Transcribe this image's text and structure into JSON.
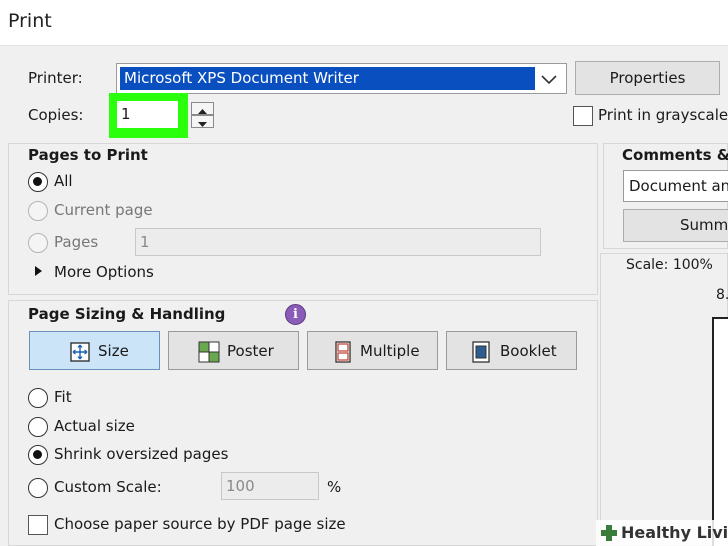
{
  "window": {
    "title": "Print"
  },
  "printer": {
    "label": "Printer:",
    "selected": "Microsoft XPS Document Writer",
    "properties_label": "Properties"
  },
  "copies": {
    "label": "Copies:",
    "value": "1"
  },
  "grayscale": {
    "label": "Print in grayscale (",
    "checked": false
  },
  "pages_to_print": {
    "heading": "Pages to Print",
    "all_label": "All",
    "current_page_label": "Current page",
    "pages_label": "Pages",
    "pages_value": "1",
    "more_options_label": "More Options",
    "selected": "All"
  },
  "page_sizing": {
    "heading": "Page Sizing & Handling",
    "info_icon_glyph": "i",
    "modes": [
      {
        "label": "Size",
        "icon": "size-icon",
        "active": true
      },
      {
        "label": "Poster",
        "icon": "poster-icon",
        "active": false
      },
      {
        "label": "Multiple",
        "icon": "multiple-icon",
        "active": false
      },
      {
        "label": "Booklet",
        "icon": "booklet-icon",
        "active": false
      }
    ],
    "fit_label": "Fit",
    "actual_size_label": "Actual size",
    "shrink_label": "Shrink oversized pages",
    "custom_scale_label": "Custom Scale:",
    "custom_scale_value": "100",
    "percent": "%",
    "selected": "Shrink oversized pages",
    "paper_source_label": "Choose paper source by PDF page size"
  },
  "comments": {
    "heading": "Comments & F",
    "selected": "Document and",
    "summarize_label": "Summ"
  },
  "preview": {
    "scale_label": "Scale: 100%",
    "page_size": "8."
  },
  "watermark": {
    "text": "Healthy Living"
  },
  "colors": {
    "highlight": "#2aff0c",
    "selection": "#0a4fbf",
    "active_mode": "#cce4f7"
  }
}
